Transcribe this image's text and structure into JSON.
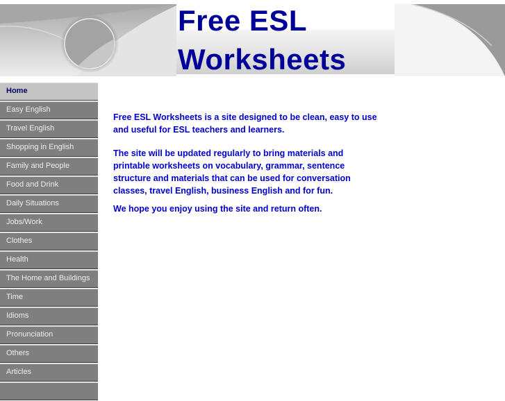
{
  "header": {
    "title_line1": "Free ESL",
    "title_line2": "Worksheets"
  },
  "sidebar": {
    "items": [
      {
        "label": "Home",
        "active": true
      },
      {
        "label": "Easy English"
      },
      {
        "label": "Travel English"
      },
      {
        "label": "Shopping in English"
      },
      {
        "label": "Family and People"
      },
      {
        "label": "Food and Drink"
      },
      {
        "label": "Daily Situations"
      },
      {
        "label": "Jobs/Work"
      },
      {
        "label": "Clothes"
      },
      {
        "label": "Health"
      },
      {
        "label": "The Home and Buildings"
      },
      {
        "label": "Time"
      },
      {
        "label": "Idioms"
      },
      {
        "label": "Pronunciation"
      },
      {
        "label": "Others"
      },
      {
        "label": "Articles"
      }
    ]
  },
  "main": {
    "paragraphs": [
      "Free ESL Worksheets is a site designed to be clean, easy to use and useful for ESL teachers and learners.",
      "The site will be updated regularly to bring materials and printable worksheets on vocabulary, grammar, sentence structure and materials that can be used for conversation classes, travel English, business English and for fun.",
      "We hope you enjoy using the site and return often."
    ]
  },
  "colors": {
    "title": "#000099",
    "body_text": "#0000cc",
    "nav_bg": "#7f7f7f",
    "nav_active_bg": "#c4c4c4"
  }
}
